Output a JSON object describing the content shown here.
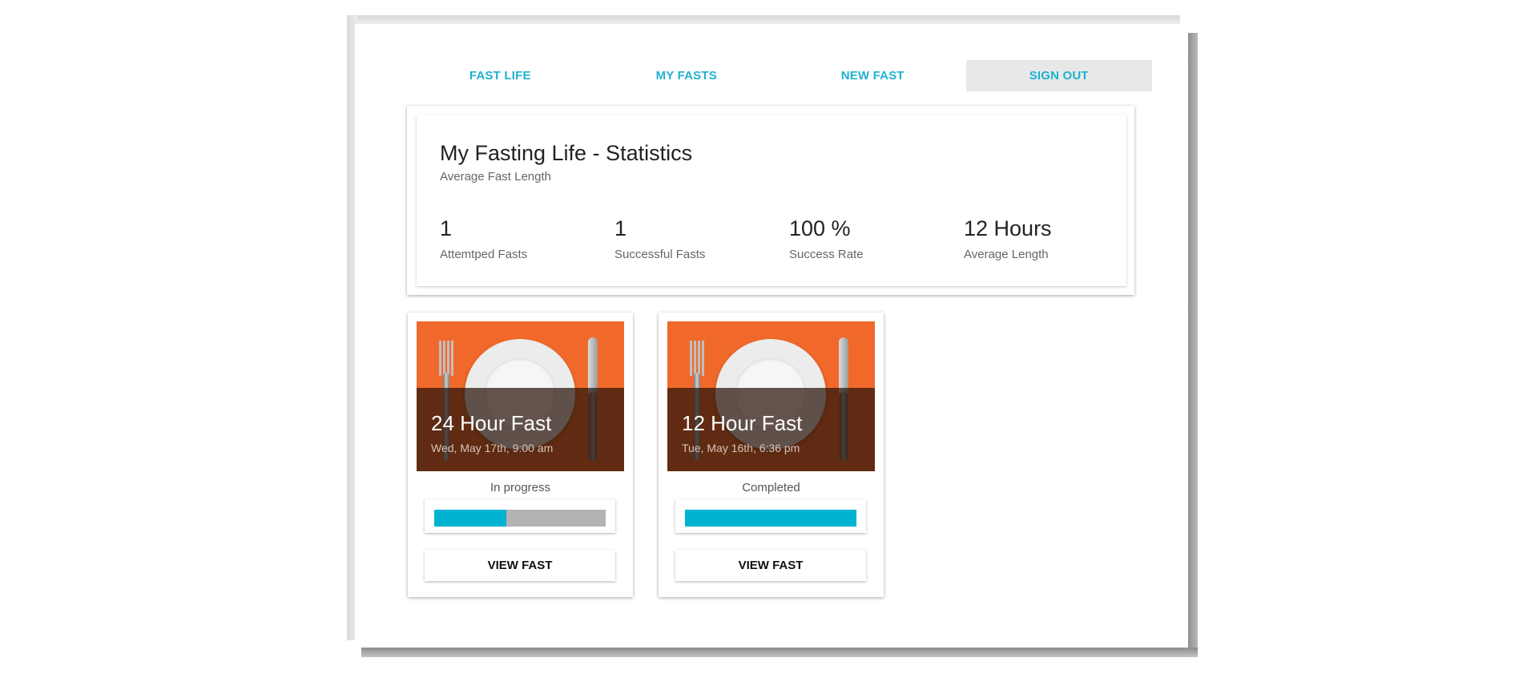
{
  "nav": {
    "items": [
      {
        "label": "FAST LIFE",
        "active": false
      },
      {
        "label": "MY FASTS",
        "active": false
      },
      {
        "label": "NEW FAST",
        "active": false
      },
      {
        "label": "SIGN OUT",
        "active": true
      }
    ]
  },
  "stats": {
    "title": "My Fasting Life - Statistics",
    "subtitle": "Average Fast Length",
    "items": [
      {
        "value": "1",
        "label": "Attemtped Fasts"
      },
      {
        "value": "1",
        "label": "Successful Fasts"
      },
      {
        "value": "100 %",
        "label": "Success Rate"
      },
      {
        "value": "12 Hours",
        "label": "Average Length"
      }
    ]
  },
  "fasts": [
    {
      "title": "24 Hour Fast",
      "date": "Wed, May 17th, 9:00 am",
      "status": "In progress",
      "progress": 0.42,
      "button": "VIEW FAST"
    },
    {
      "title": "12 Hour Fast",
      "date": "Tue, May 16th, 6:36 pm",
      "status": "Completed",
      "progress": 1.0,
      "button": "VIEW FAST"
    }
  ],
  "colors": {
    "accent": "#1fb1d0",
    "progress_fill": "#00b3d0",
    "progress_track": "#b3b3b3",
    "image_background": "#f0692a",
    "nav_active_bg": "#e8e8e8"
  },
  "icons": {
    "card_image": "plate-fork-knife-image"
  }
}
